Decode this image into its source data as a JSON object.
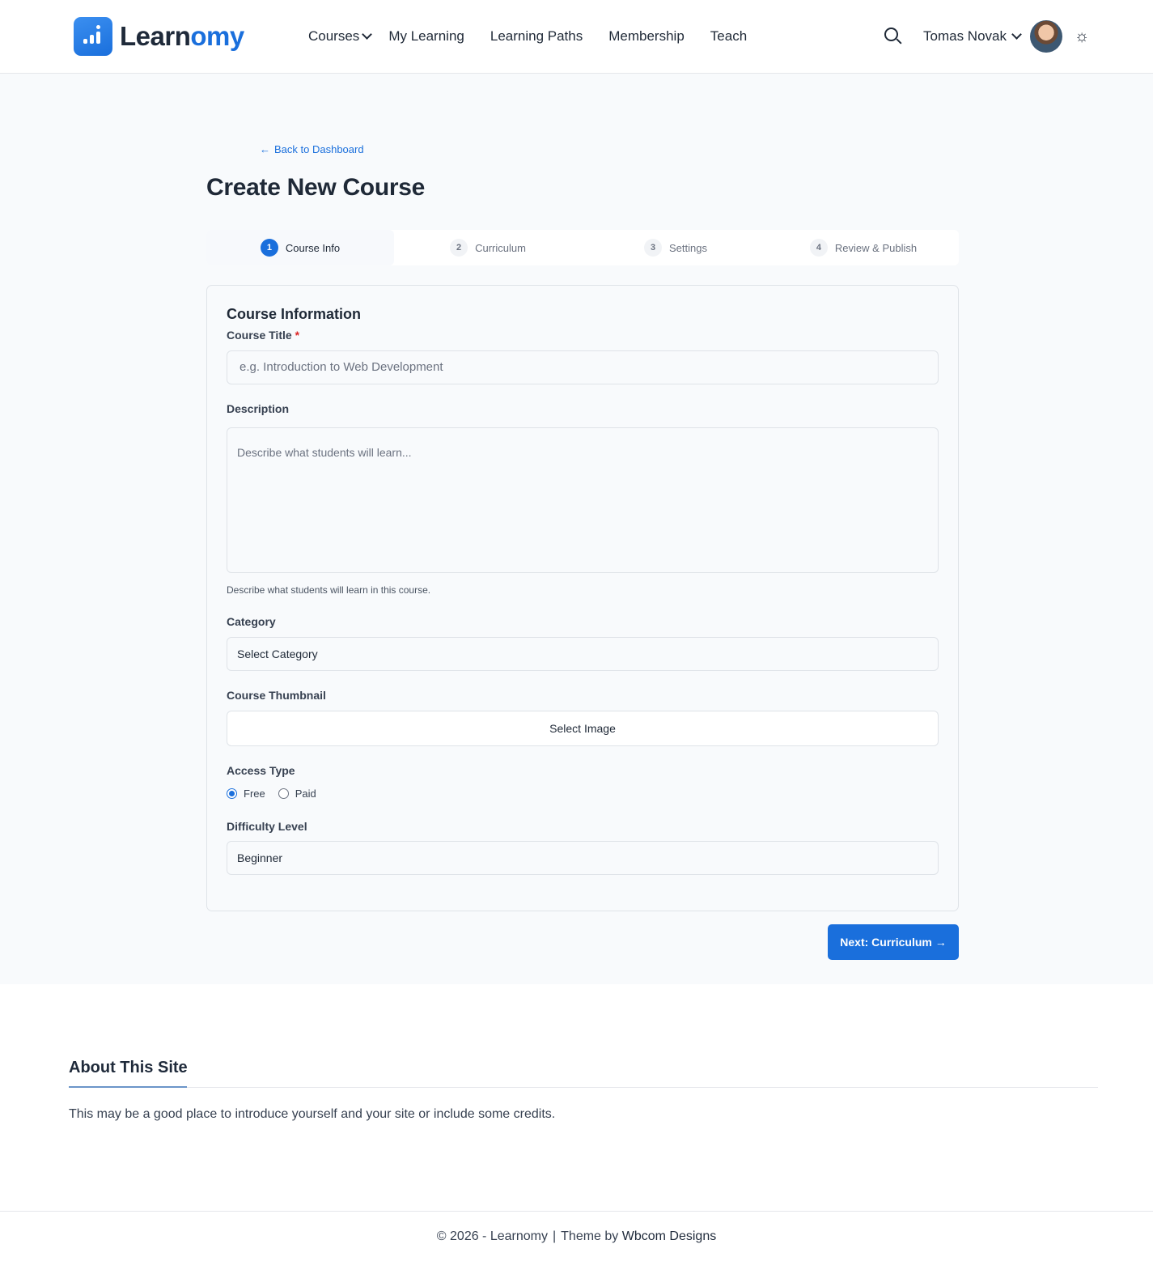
{
  "header": {
    "logo": {
      "part1": "Learn",
      "part2": "omy"
    },
    "nav": [
      "Courses",
      "My Learning",
      "Learning Paths",
      "Membership",
      "Teach"
    ],
    "user": {
      "name": "Tomas Novak"
    },
    "icons": {
      "search": "search-icon",
      "theme": "sun-icon"
    }
  },
  "page": {
    "back_link": "Back to Dashboard",
    "title": "Create New Course"
  },
  "steps": [
    {
      "num": "1",
      "label": "Course Info",
      "active": true
    },
    {
      "num": "2",
      "label": "Curriculum"
    },
    {
      "num": "3",
      "label": "Settings"
    },
    {
      "num": "4",
      "label": "Review & Publish"
    }
  ],
  "form": {
    "section_title": "Course Information",
    "title_label": "Course Title",
    "required_mark": "*",
    "title_placeholder": "e.g. Introduction to Web Development",
    "description_label": "Description",
    "description_placeholder": "Describe what students will learn...",
    "description_help": "Describe what students will learn in this course.",
    "category_label": "Category",
    "category_value": "Select Category",
    "thumbnail_label": "Course Thumbnail",
    "thumbnail_button": "Select Image",
    "access_label": "Access Type",
    "access_options": [
      "Free",
      "Paid"
    ],
    "access_selected": "Free",
    "difficulty_label": "Difficulty Level",
    "difficulty_value": "Beginner"
  },
  "next_button": "Next: Curriculum →",
  "about": {
    "title": "About This Site",
    "text": "This may be a good place to introduce yourself and your site or include some credits."
  },
  "footer": {
    "copyright": "© 2026 - Learnomy",
    "separator": "|",
    "theme_by": "Theme by",
    "theme_author": "Wbcom Designs"
  },
  "colors": {
    "accent": "#1a6fdc",
    "required": "#dc2626"
  }
}
